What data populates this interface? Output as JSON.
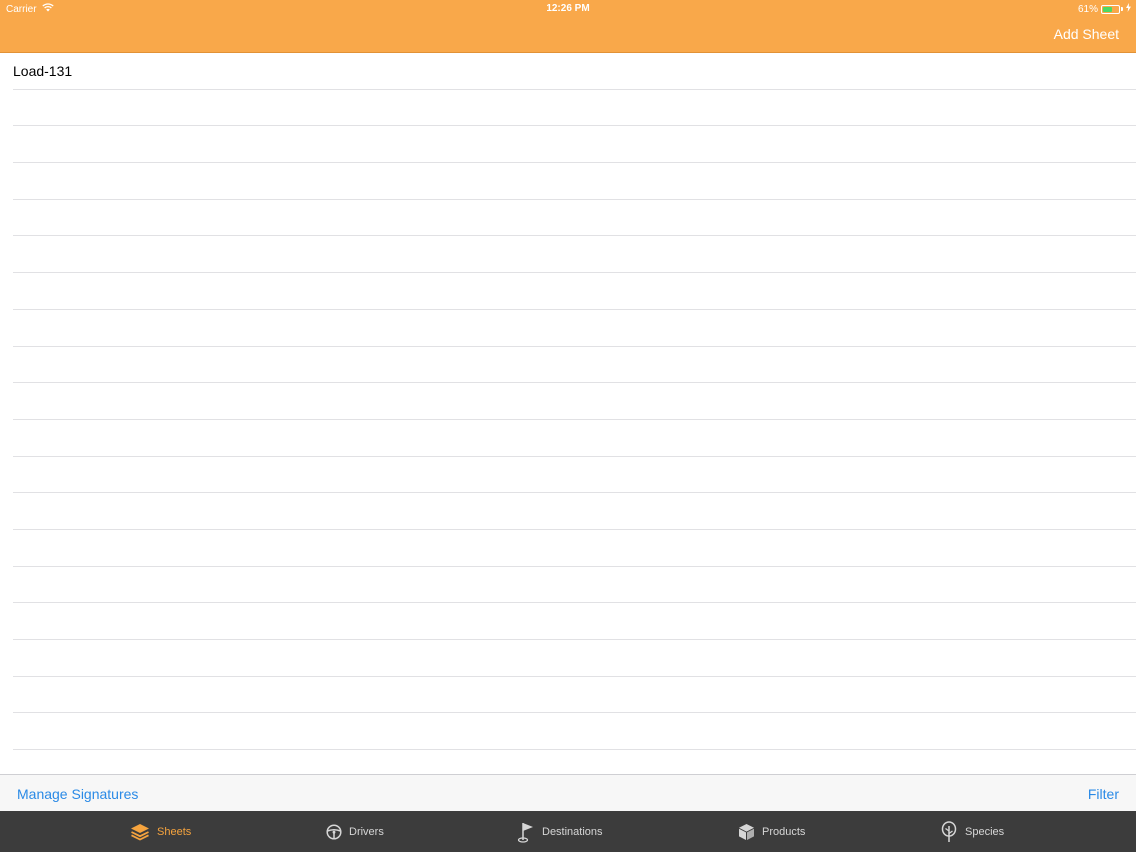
{
  "status_bar": {
    "carrier": "Carrier",
    "time": "12:26 PM",
    "battery_percent": "61%",
    "battery_level": 0.61
  },
  "nav": {
    "add_button": "Add Sheet"
  },
  "list": {
    "items": [
      "Load-131"
    ],
    "empty_rows": 18
  },
  "toolbar": {
    "left_button": "Manage Signatures",
    "right_button": "Filter"
  },
  "tabs": [
    {
      "label": "Sheets",
      "icon": "layers-icon",
      "active": true
    },
    {
      "label": "Drivers",
      "icon": "steering-wheel-icon",
      "active": false
    },
    {
      "label": "Destinations",
      "icon": "flag-icon",
      "active": false
    },
    {
      "label": "Products",
      "icon": "box-icon",
      "active": false
    },
    {
      "label": "Species",
      "icon": "tree-icon",
      "active": false
    }
  ],
  "colors": {
    "accent": "#f9a84a",
    "link": "#2a8ae6",
    "tabbar": "#3c3c3c",
    "active_tab": "#f5a33e"
  }
}
